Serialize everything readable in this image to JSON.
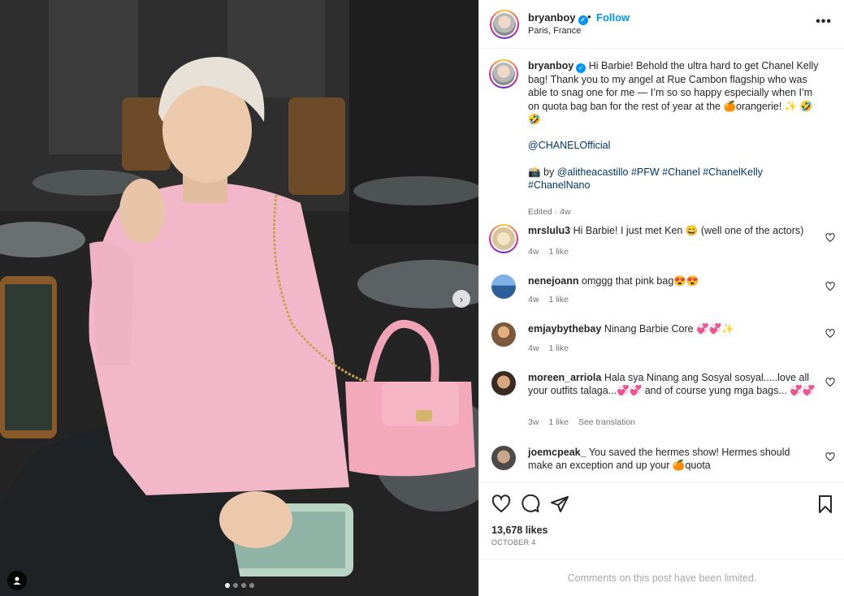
{
  "post": {
    "username": "bryanboy",
    "follow_label": "Follow",
    "location": "Paris, France",
    "more_label": "•••",
    "caption": {
      "text_1": "Hi Barbie! Behold the ultra hard to get Chanel Kelly bag! Thank you to my angel at Rue Cambon flagship who was able to snag one for me — I’m so so happy especially when I’m on quota bag ban for the rest of year at the 🍊orangerie! ✨ 🤣",
      "text_2": "🤣",
      "mention": "@CHANELOfficial",
      "credit_prefix": "📸 by",
      "credit_mention": "@alitheacastillo",
      "hashtags": [
        "#PFW",
        "#Chanel",
        "#ChanelKelly",
        "#ChanelNano"
      ],
      "meta": "Edited · 4w"
    }
  },
  "comments": [
    {
      "username": "mrslulu3",
      "text": "Hi Barbie! I just met Ken 😄 (well one of the actors)",
      "time": "4w",
      "likes": "1 like"
    },
    {
      "username": "nenejoann",
      "text": "omggg that pink bag😍😍",
      "time": "4w",
      "likes": "1 like"
    },
    {
      "username": "emjaybythebay",
      "text": "Ninang Barbie Core 💞💞✨",
      "time": "4w",
      "likes": "1 like"
    },
    {
      "username": "moreen_arriola",
      "text": "Hala sya Ninang ang Sosyal sosyal.....love all your outfits talaga...💞💞 and of course yung mga bags... 💞💞",
      "time": "3w",
      "likes": "1 like",
      "extra": "See translation"
    },
    {
      "username": "joemcpeak_",
      "text": "You saved the hermes show! Hermes should make an exception and up your 🍊quota"
    }
  ],
  "actions": {
    "likes": "13,678 likes",
    "date": "OCTOBER 4",
    "limited_note": "Comments on this post have been limited."
  },
  "carousel": {
    "current": 1,
    "total": 4
  },
  "colors": {
    "accent": "#0095f6",
    "link": "#00376b",
    "muted": "#737373",
    "heart_red": "#ed4956"
  }
}
